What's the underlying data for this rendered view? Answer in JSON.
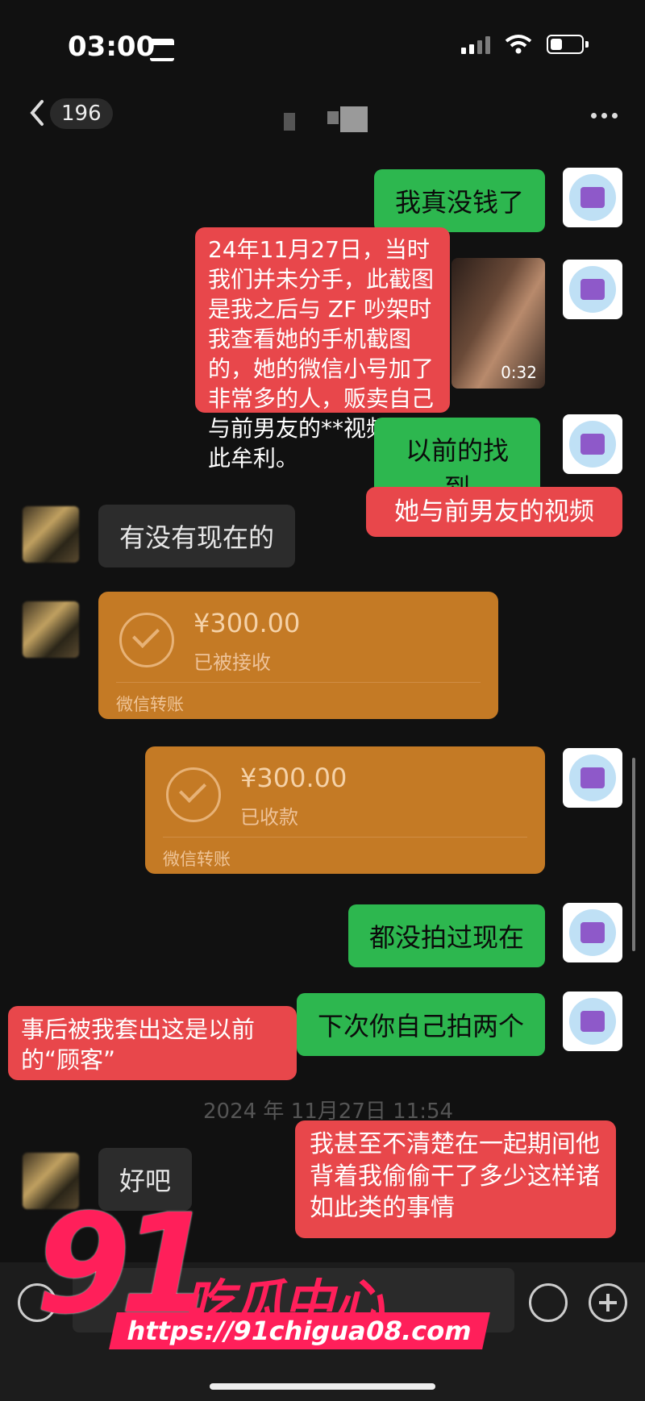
{
  "status": {
    "time": "03:00"
  },
  "header": {
    "unread_count": "196"
  },
  "messages": {
    "m1": "我真没钱了",
    "video_duration": "0:32",
    "m2": "以前的找到",
    "m3": "有没有现在的",
    "transfer1": {
      "amount": "¥300.00",
      "status": "已被接收",
      "footer": "微信转账"
    },
    "transfer2": {
      "amount": "¥300.00",
      "status": "已收款",
      "footer": "微信转账"
    },
    "m4": "都没拍过现在",
    "m5": "下次你自己拍两个",
    "timestamp": "2024 年 11月27日 11:54",
    "m6": "好吧"
  },
  "annotations": {
    "a1": "24年11月27日，当时我们并未分手，此截图是我之后与 ZF 吵架时我查看她的手机截图的，她的微信小号加了非常多的人，贩卖自己与前男友的**视频，以此牟利。",
    "a2": "她与前男友的视频",
    "a3": "事后被我套出这是以前的“顾客”",
    "a4": "我甚至不清楚在一起期间他背着我偷偷干了多少这样诸如此类的事情"
  },
  "watermark": {
    "logo_number": "91",
    "logo_text": "吃瓜中心",
    "url": "https://91chigua08.com"
  },
  "colors": {
    "green_bubble": "#2db74f",
    "annotation_red": "#e8474b",
    "transfer_orange": "#c47a25",
    "watermark_pink": "#ff1f5a"
  }
}
